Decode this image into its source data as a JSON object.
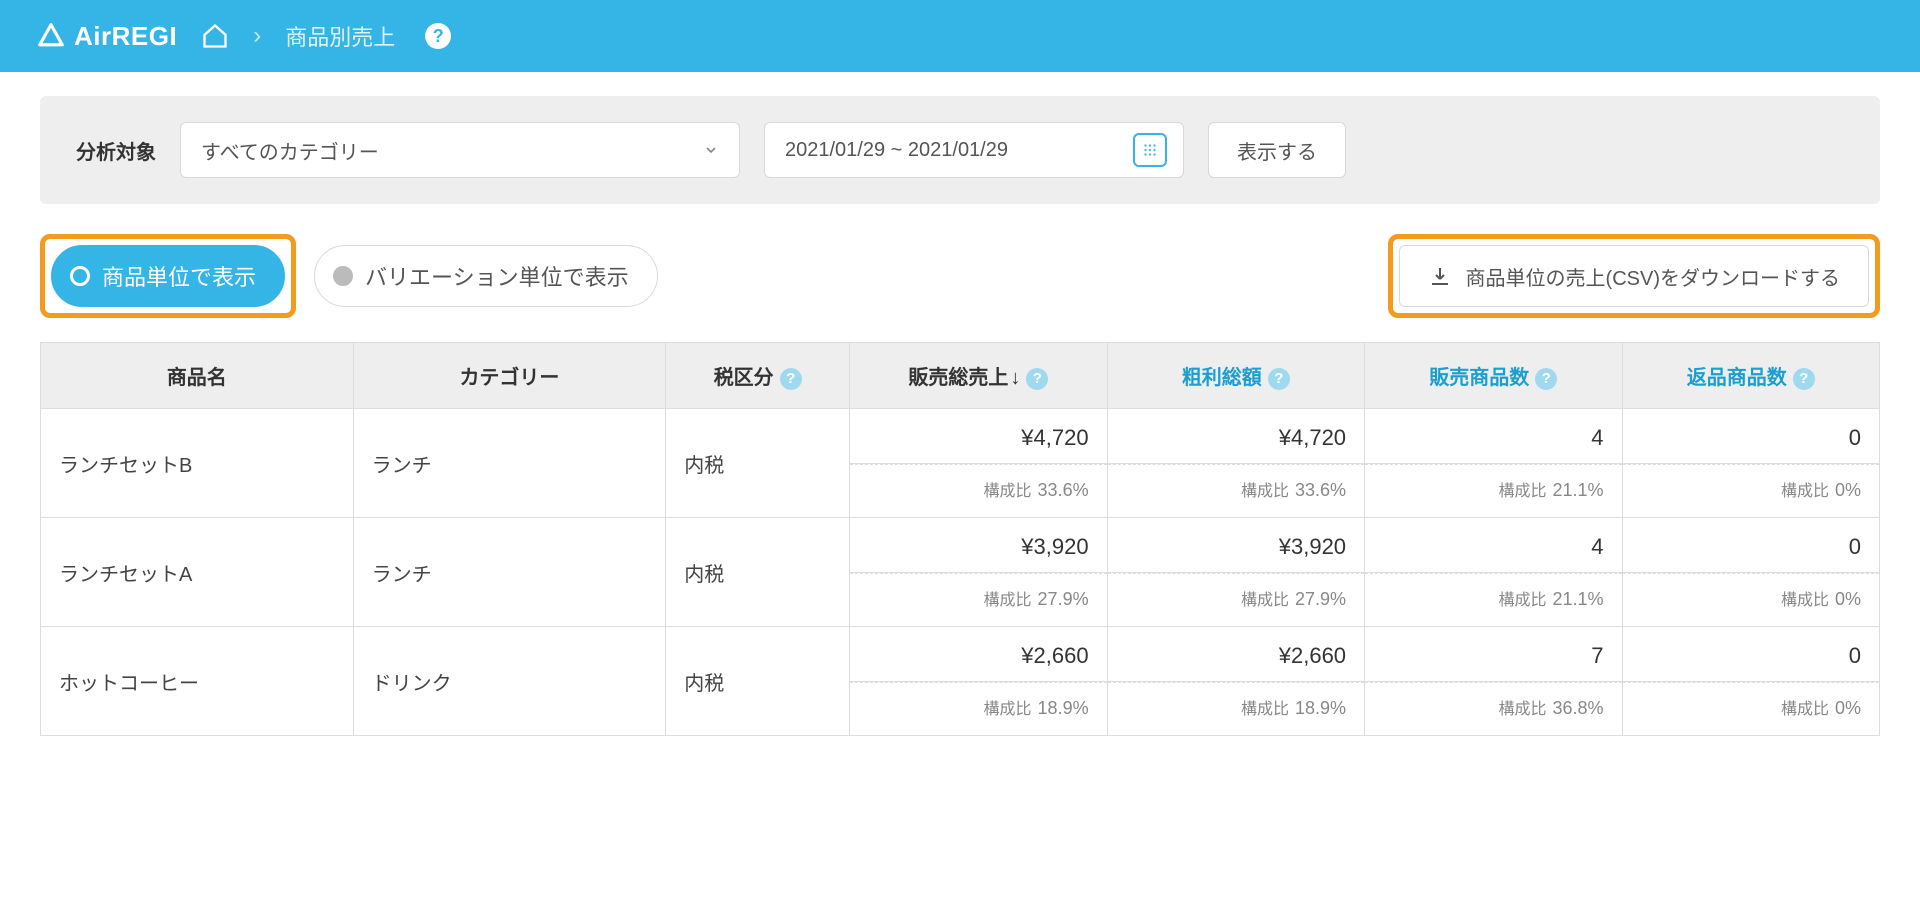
{
  "header": {
    "logo_text": "AirREGI",
    "breadcrumb": "商品別売上"
  },
  "filter": {
    "label": "分析対象",
    "category_value": "すべてのカテゴリー",
    "date_range": "2021/01/29 ~ 2021/01/29",
    "show_button": "表示する"
  },
  "toolbar": {
    "toggle_product": "商品単位で表示",
    "toggle_variation": "バリエーション単位で表示",
    "download_label": "商品単位の売上(CSV)をダウンロードする"
  },
  "table": {
    "ratio_label": "構成比",
    "headers": {
      "name": "商品名",
      "category": "カテゴリー",
      "tax": "税区分",
      "sales": "販売総売上",
      "profit": "粗利総額",
      "sold_qty": "販売商品数",
      "return_qty": "返品商品数"
    },
    "rows": [
      {
        "name": "ランチセットB",
        "category": "ランチ",
        "tax": "内税",
        "sales": "¥4,720",
        "sales_ratio": "33.6%",
        "profit": "¥4,720",
        "profit_ratio": "33.6%",
        "sold_qty": "4",
        "sold_ratio": "21.1%",
        "return_qty": "0",
        "return_ratio": "0%"
      },
      {
        "name": "ランチセットA",
        "category": "ランチ",
        "tax": "内税",
        "sales": "¥3,920",
        "sales_ratio": "27.9%",
        "profit": "¥3,920",
        "profit_ratio": "27.9%",
        "sold_qty": "4",
        "sold_ratio": "21.1%",
        "return_qty": "0",
        "return_ratio": "0%"
      },
      {
        "name": "ホットコーヒー",
        "category": "ドリンク",
        "tax": "内税",
        "sales": "¥2,660",
        "sales_ratio": "18.9%",
        "profit": "¥2,660",
        "profit_ratio": "18.9%",
        "sold_qty": "7",
        "sold_ratio": "36.8%",
        "return_qty": "0",
        "return_ratio": "0%"
      }
    ]
  }
}
